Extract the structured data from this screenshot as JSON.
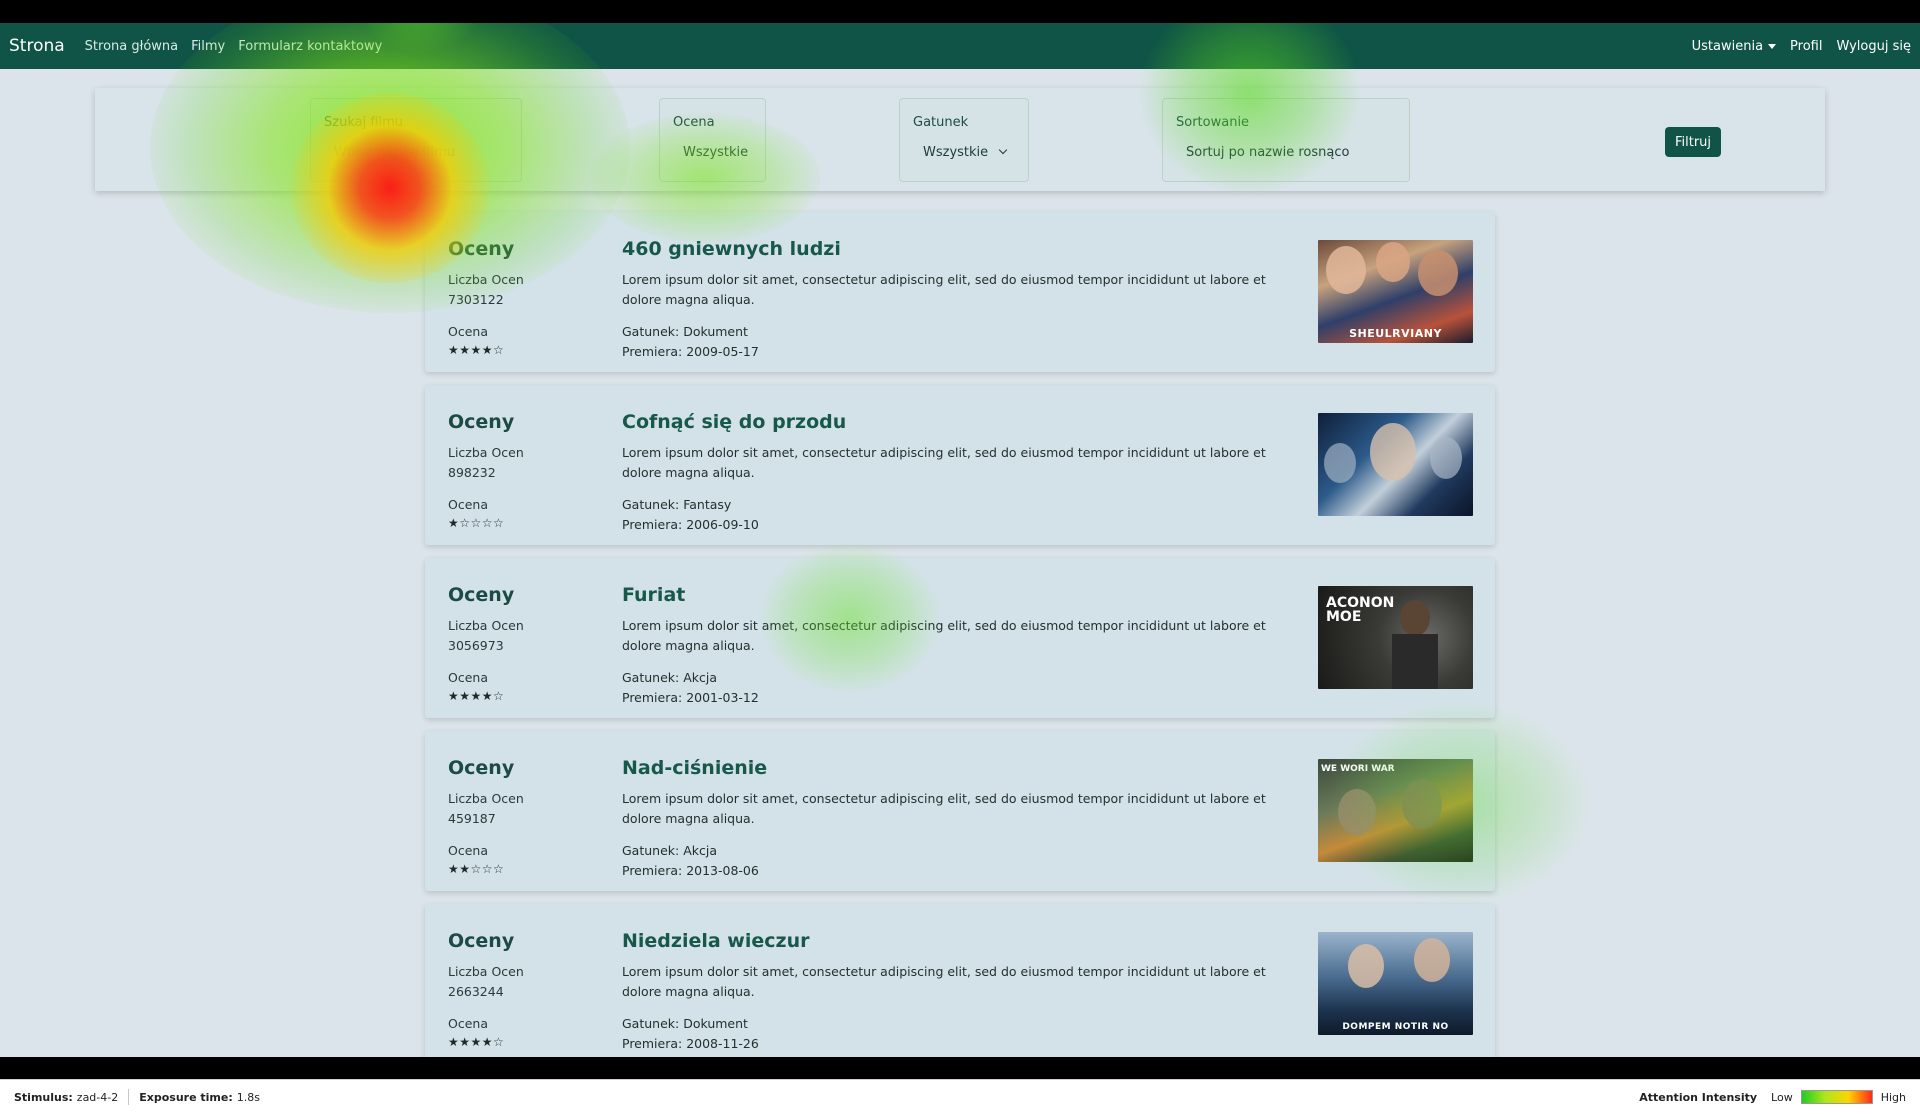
{
  "navbar": {
    "brand": "Strona",
    "links": [
      "Strona główna",
      "Filmy",
      "Formularz kontaktowy"
    ],
    "settings": "Ustawienia",
    "profile": "Profil",
    "logout": "Wyloguj się"
  },
  "filters": {
    "search": {
      "label": "Szukaj filmu",
      "placeholder": "Wpisz nazwę filmu"
    },
    "rating": {
      "label": "Ocena",
      "value": "Wszystkie"
    },
    "genre": {
      "label": "Gatunek",
      "value": "Wszystkie"
    },
    "sort": {
      "label": "Sortowanie",
      "value": "Sortuj po nazwie rosnąco"
    },
    "button": "Filtruj"
  },
  "movies": [
    {
      "ratings_label": "Oceny",
      "count_label": "Liczba Ocen",
      "count": "7303122",
      "rating_label": "Ocena",
      "stars": "★★★★☆",
      "title": "460 gniewnych ludzi",
      "description": "Lorem ipsum dolor sit amet, consectetur adipiscing elit, sed do eiusmod tempor incididunt ut labore et dolore magna aliqua.",
      "genre": "Gatunek: Dokument",
      "premiere": "Premiera: 2009-05-17",
      "poster_text": "SHEULRVIANY"
    },
    {
      "ratings_label": "Oceny",
      "count_label": "Liczba Ocen",
      "count": "898232",
      "rating_label": "Ocena",
      "stars": "★☆☆☆☆",
      "title": "Cofnąć się do przodu",
      "description": "Lorem ipsum dolor sit amet, consectetur adipiscing elit, sed do eiusmod tempor incididunt ut labore et dolore magna aliqua.",
      "genre": "Gatunek: Fantasy",
      "premiere": "Premiera: 2006-09-10",
      "poster_text": ""
    },
    {
      "ratings_label": "Oceny",
      "count_label": "Liczba Ocen",
      "count": "3056973",
      "rating_label": "Ocena",
      "stars": "★★★★☆",
      "title": "Furiat",
      "description": "Lorem ipsum dolor sit amet, consectetur adipiscing elit, sed do eiusmod tempor incididunt ut labore et dolore magna aliqua.",
      "genre": "Gatunek: Akcja",
      "premiere": "Premiera: 2001-03-12",
      "poster_text": "ACONON MOE"
    },
    {
      "ratings_label": "Oceny",
      "count_label": "Liczba Ocen",
      "count": "459187",
      "rating_label": "Ocena",
      "stars": "★★☆☆☆",
      "title": "Nad-ciśnienie",
      "description": "Lorem ipsum dolor sit amet, consectetur adipiscing elit, sed do eiusmod tempor incididunt ut labore et dolore magna aliqua.",
      "genre": "Gatunek: Akcja",
      "premiere": "Premiera: 2013-08-06",
      "poster_text": "WE WORI WAR"
    },
    {
      "ratings_label": "Oceny",
      "count_label": "Liczba Ocen",
      "count": "2663244",
      "rating_label": "Ocena",
      "stars": "★★★★☆",
      "title": "Niedziela wieczur",
      "description": "Lorem ipsum dolor sit amet, consectetur adipiscing elit, sed do eiusmod tempor incididunt ut labore et dolore magna aliqua.",
      "genre": "Gatunek: Dokument",
      "premiere": "Premiera: 2008-11-26",
      "poster_text": "DOMPEM NOTIR NO"
    }
  ],
  "statusbar": {
    "stimulus_label": "Stimulus:",
    "stimulus_value": "zad-4-2",
    "exposure_label": "Exposure time:",
    "exposure_value": "1.8s",
    "intensity_label": "Attention Intensity",
    "low": "Low",
    "high": "High"
  }
}
